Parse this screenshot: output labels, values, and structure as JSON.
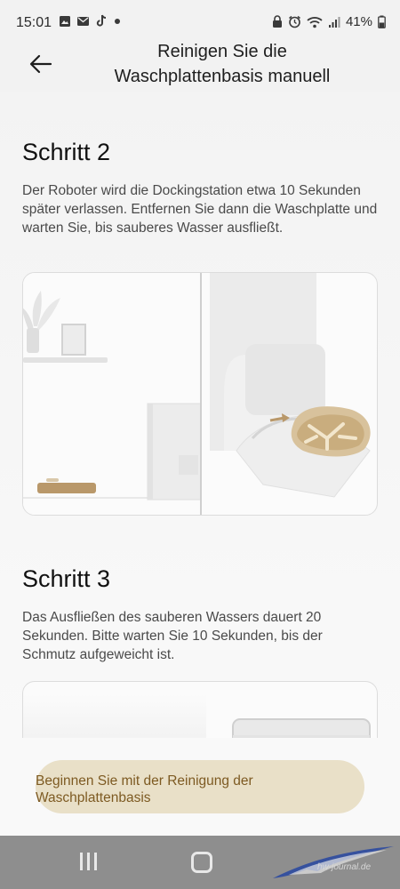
{
  "status_bar": {
    "time": "15:01",
    "left_icons": [
      "gallery-icon",
      "message-icon",
      "tiktok-icon",
      "dot-icon"
    ],
    "right_icons": [
      "lock-icon",
      "alarm-icon",
      "wifi-icon",
      "signal-icon"
    ],
    "battery": "41%"
  },
  "header": {
    "back_icon": "arrow-left-icon",
    "title_line1": "Reinigen Sie die",
    "title_line2": "Waschplattenbasis manuell"
  },
  "steps": [
    {
      "title": "Schritt 2",
      "text": "Der Roboter wird die Dockingstation etwa 10 Sekunden später verlassen. Entfernen Sie dann die Waschplatte und warten Sie, bis sauberes Wasser ausfließt."
    },
    {
      "title": "Schritt 3",
      "text": "Das Ausfließen des sauberen Wassers dauert 20 Sekunden. Bitte warten Sie 10 Sekunden, bis der Schmutz aufgeweicht ist."
    }
  ],
  "primary_button": {
    "line1": "Beginnen Sie mit der Reinigung der",
    "line2": "Waschplattenbasis"
  },
  "nav_bar": {
    "recents_icon": "recents-icon",
    "home_icon": "home-icon"
  },
  "watermark": {
    "text": "hw-journal.de"
  },
  "colors": {
    "button_bg": "#e9e0c8",
    "button_text": "#7d5a22",
    "accent_gold": "#b9986a"
  }
}
